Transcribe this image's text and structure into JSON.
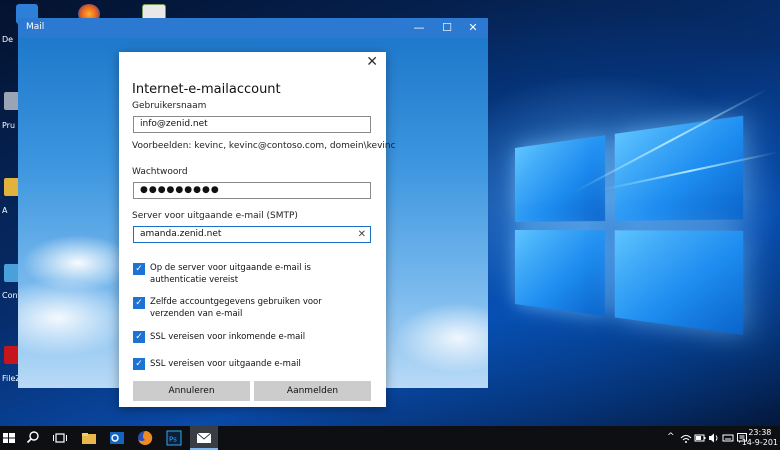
{
  "desktop": {
    "labels": [
      "De",
      "Pru",
      "A",
      "Configu",
      "FileZi"
    ]
  },
  "mail_window": {
    "title": "Mail",
    "minimize": "—",
    "maximize": "☐",
    "close": "✕"
  },
  "dialog": {
    "close": "✕",
    "title": "Internet-e-mailaccount",
    "username_label": "Gebruikersnaam",
    "username_value": "info@zenid.net",
    "username_hint": "Voorbeelden: kevinc, kevinc@contoso.com, domein\\kevinc",
    "password_label": "Wachtwoord",
    "password_value": "●●●●●●●●●",
    "smtp_label": "Server voor uitgaande e-mail (SMTP)",
    "smtp_value": "amanda.zenid.net",
    "smtp_clear": "✕",
    "checkboxes": [
      {
        "label": "Op de server voor uitgaande e-mail is authenticatie vereist",
        "checked": true
      },
      {
        "label": "Zelfde accountgegevens gebruiken voor verzenden van e-mail",
        "checked": true
      },
      {
        "label": "SSL vereisen voor inkomende e-mail",
        "checked": true
      },
      {
        "label": "SSL vereisen voor uitgaande e-mail",
        "checked": true
      }
    ],
    "check_mark": "✓",
    "cancel_label": "Annuleren",
    "signin_label": "Aanmelden"
  },
  "taskbar": {
    "time": "23:38",
    "date": "14-9-201",
    "tray_chevron": "^"
  },
  "colors": {
    "accent": "#1c73d4",
    "titlebar": "#2b79d0",
    "taskbar": "#0d0f13"
  }
}
